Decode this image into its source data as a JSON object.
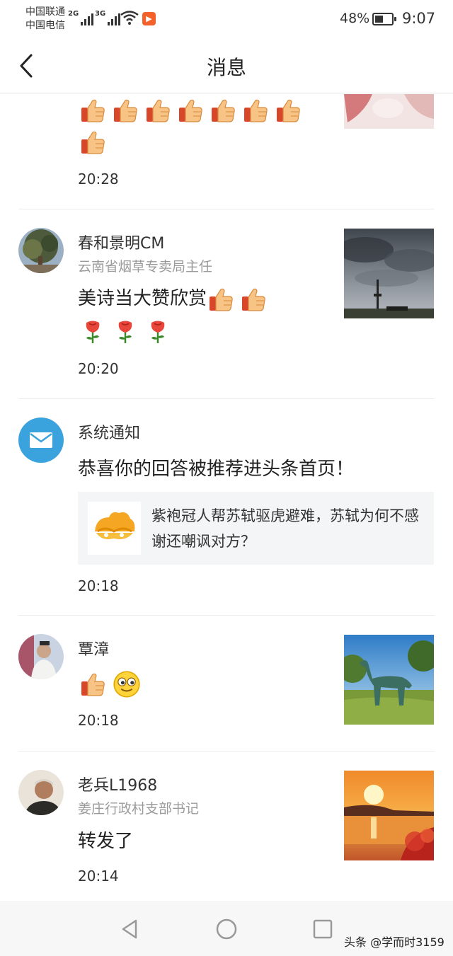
{
  "status_bar": {
    "carrier_1": "中国联通",
    "carrier_2": "中国电信",
    "network_1": "2G",
    "network_2": "3G",
    "battery": "48%",
    "battery_level": 0.48,
    "time": "9:07"
  },
  "header": {
    "title": "消息",
    "back_icon": "chevron-left-icon"
  },
  "notifications": [
    {
      "type": "comment-partial",
      "emojis": [
        "thumbs-up",
        "thumbs-up",
        "thumbs-up",
        "thumbs-up",
        "thumbs-up",
        "thumbs-up",
        "thumbs-up",
        "thumbs-up"
      ],
      "time": "20:28"
    },
    {
      "type": "comment",
      "name": "春和景明CM",
      "subtitle": "云南省烟草专卖局主任",
      "text": "美诗当大赞欣赏",
      "emojis_inline": [
        "thumbs-up",
        "thumbs-up"
      ],
      "emojis_line2": [
        "rose",
        "rose",
        "rose"
      ],
      "time": "20:20"
    },
    {
      "type": "system",
      "name": "系统通知",
      "text": "恭喜你的回答被推荐进头条首页！",
      "card_text": "紫袍冠人帮苏轼驱虎避难，苏轼为何不感谢还嘲讽对方？",
      "time": "20:18"
    },
    {
      "type": "comment",
      "name": "覃漳",
      "emojis": [
        "thumbs-up",
        "smiley"
      ],
      "time": "20:18"
    },
    {
      "type": "comment",
      "name": "老兵L1968",
      "subtitle": "姜庄行政村支部书记",
      "text": "转发了",
      "time": "20:14"
    }
  ],
  "navbar": {
    "back": "back-triangle-icon",
    "home": "home-circle-icon",
    "recents": "recents-square-icon"
  },
  "watermark": "头条 @学而时3159",
  "colors": {
    "system_icon_bg": "#3aa3dd",
    "thumb_up": "#f7c485",
    "rose": "#e8463a",
    "app_icon": "#f2622a"
  }
}
